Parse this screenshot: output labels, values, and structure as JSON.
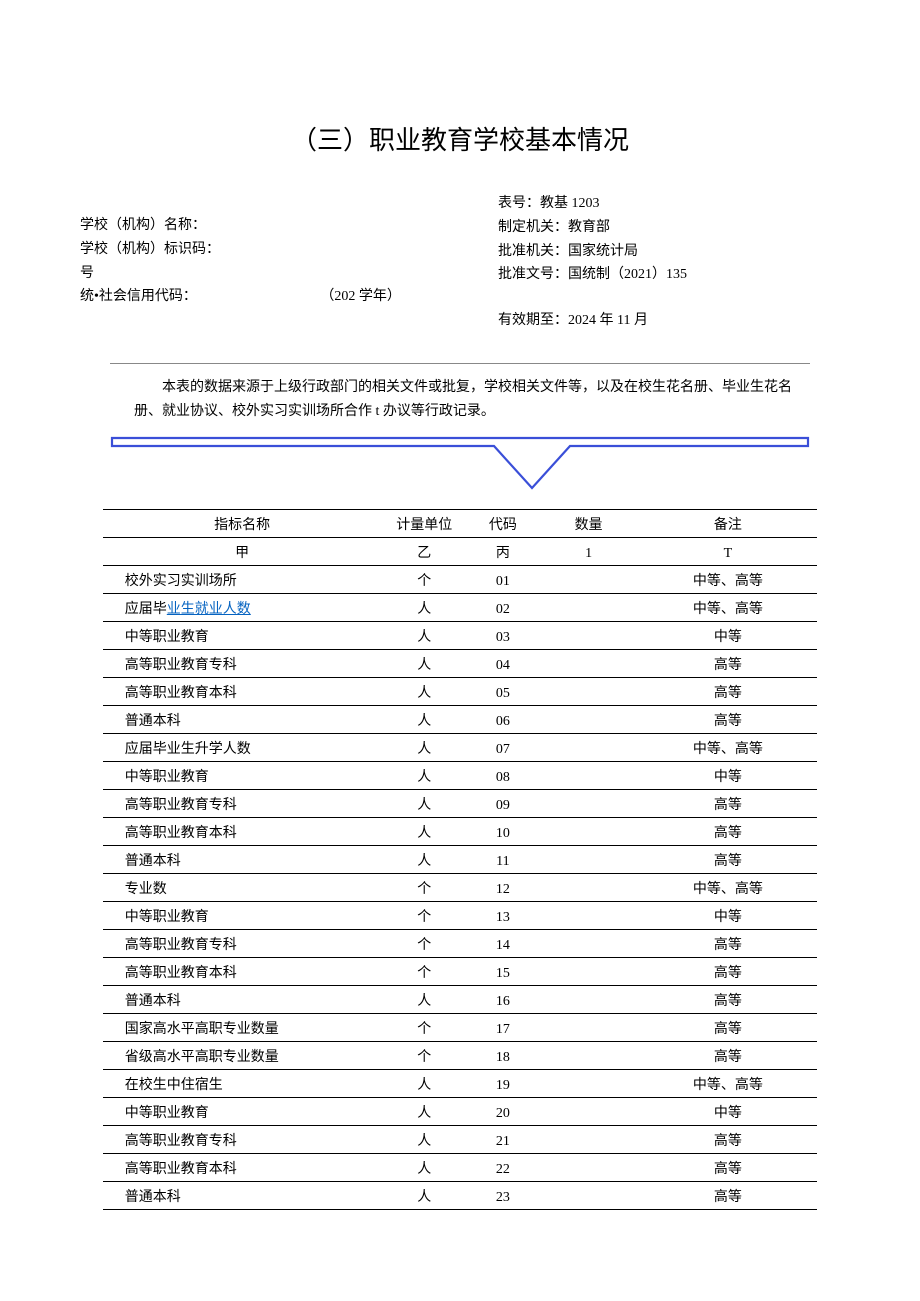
{
  "title": "（三）职业教育学校基本情况",
  "header": {
    "left": {
      "school_name_label": "学校（机构）名称：",
      "school_code_label": "学校（机构）标识码：",
      "hao": "号",
      "credit_label": "统•社会信用代码：",
      "year_text": "（202 学年）"
    },
    "right": {
      "table_no": "表号：教基 1203",
      "maker": "制定机关：教育部",
      "approver": "批准机关：国家统计局",
      "approval_no": "批准文号：国统制（2021）135",
      "valid_until": "有效期至：2024 年 11 月"
    }
  },
  "note": "本表的数据来源于上级行政部门的相关文件或批复，学校相关文件等，以及在校生花名册、毕业生花名册、就业协议、校外实习实训场所合作 t 办议等行政记录。",
  "columns": {
    "name": "指标名称",
    "unit": "计量单位",
    "code": "代码",
    "qty": "数量",
    "remark": "备注"
  },
  "subheader": {
    "name": "甲",
    "unit": "乙",
    "code": "丙",
    "qty": "1",
    "remark": "T"
  },
  "rows": [
    {
      "name": "校外实习实训场所",
      "indent": 1,
      "unit": "个",
      "code": "01",
      "qty": "",
      "remark": "中等、高等"
    },
    {
      "name_prefix": "应届毕",
      "name_linked": "业生就业人数",
      "indent": 1,
      "unit": "人",
      "code": "02",
      "qty": "",
      "remark": "中等、高等"
    },
    {
      "name": "中等职业教育",
      "indent": 2,
      "unit": "人",
      "code": "03",
      "qty": "",
      "remark": "中等"
    },
    {
      "name": "高等职业教育专科",
      "indent": 2,
      "unit": "人",
      "code": "04",
      "qty": "",
      "remark": "高等"
    },
    {
      "name": "高等职业教育本科",
      "indent": 2,
      "unit": "人",
      "code": "05",
      "qty": "",
      "remark": "高等"
    },
    {
      "name": "普通本科",
      "indent": 2,
      "unit": "人",
      "code": "06",
      "qty": "",
      "remark": "高等"
    },
    {
      "name": "应届毕业生升学人数",
      "indent": 1,
      "unit": "人",
      "code": "07",
      "qty": "",
      "remark": "中等、高等"
    },
    {
      "name": "中等职业教育",
      "indent": 2,
      "unit": "人",
      "code": "08",
      "qty": "",
      "remark": "中等"
    },
    {
      "name": "高等职业教育专科",
      "indent": 2,
      "unit": "人",
      "code": "09",
      "qty": "",
      "remark": "高等"
    },
    {
      "name": "高等职业教育本科",
      "indent": 2,
      "unit": "人",
      "code": "10",
      "qty": "",
      "remark": "高等"
    },
    {
      "name": "普通本科",
      "indent": 2,
      "unit": "人",
      "code": "11",
      "qty": "",
      "remark": "高等"
    },
    {
      "name": "专业数",
      "indent": 1,
      "unit": "个",
      "code": "12",
      "qty": "",
      "remark": "中等、高等"
    },
    {
      "name": "中等职业教育",
      "indent": 2,
      "unit": "个",
      "code": "13",
      "qty": "",
      "remark": "中等"
    },
    {
      "name": "高等职业教育专科",
      "indent": 2,
      "unit": "个",
      "code": "14",
      "qty": "",
      "remark": "高等"
    },
    {
      "name": "高等职业教育本科",
      "indent": 2,
      "unit": "个",
      "code": "15",
      "qty": "",
      "remark": "高等"
    },
    {
      "name": "普通本科",
      "indent": 2,
      "unit": "人",
      "code": "16",
      "qty": "",
      "remark": "高等"
    },
    {
      "name": "国家高水平高职专业数量",
      "indent": 1,
      "unit": "个",
      "code": "17",
      "qty": "",
      "remark": "高等"
    },
    {
      "name": "省级高水平高职专业数量",
      "indent": 1,
      "unit": "个",
      "code": "18",
      "qty": "",
      "remark": "高等"
    },
    {
      "name": "在校生中住宿生",
      "indent": 1,
      "unit": "人",
      "code": "19",
      "qty": "",
      "remark": "中等、高等"
    },
    {
      "name": "中等职业教育",
      "indent": 2,
      "unit": "人",
      "code": "20",
      "qty": "",
      "remark": "中等"
    },
    {
      "name": "高等职业教育专科",
      "indent": 2,
      "unit": "人",
      "code": "21",
      "qty": "",
      "remark": "高等"
    },
    {
      "name": "高等职业教育本科",
      "indent": 2,
      "unit": "人",
      "code": "22",
      "qty": "",
      "remark": "高等"
    },
    {
      "name": "普通本科",
      "indent": 2,
      "unit": "人",
      "code": "23",
      "qty": "",
      "remark": "高等"
    }
  ]
}
